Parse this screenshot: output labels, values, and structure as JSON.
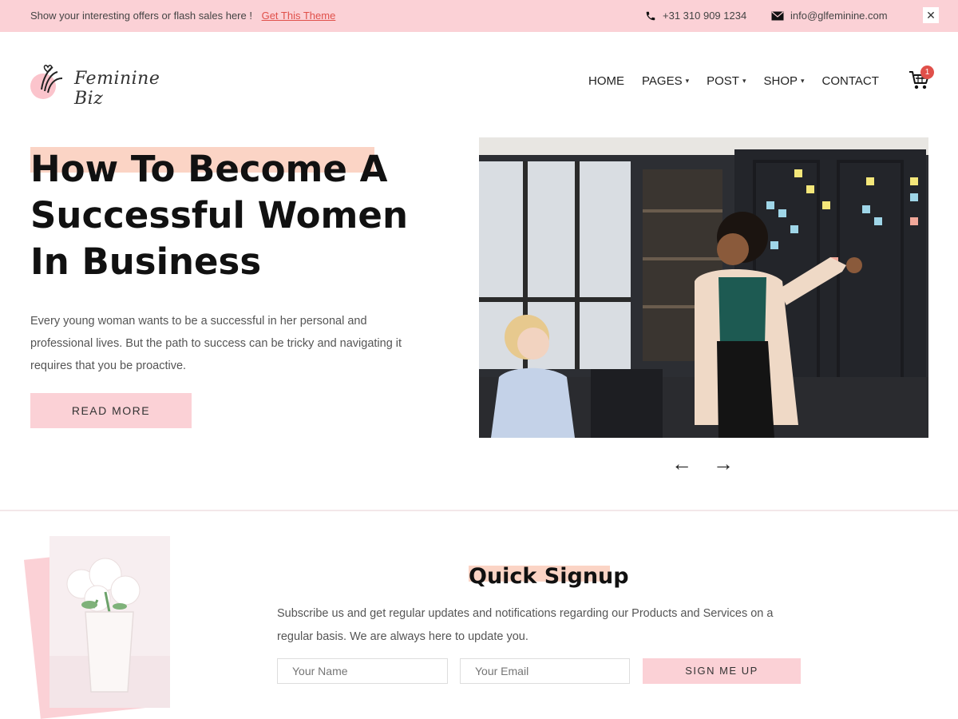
{
  "topbar": {
    "offer_text": "Show your interesting offers or flash sales here !",
    "offer_link": "Get This Theme",
    "phone": "+31 310 909 1234",
    "email": "info@glfeminine.com",
    "phone_icon": "phone-icon",
    "email_icon": "mail-icon",
    "close_icon": "close-icon"
  },
  "header": {
    "logo_text": "Feminine Biz",
    "nav": [
      {
        "label": "HOME",
        "dropdown": false
      },
      {
        "label": "PAGES",
        "dropdown": true
      },
      {
        "label": "POST",
        "dropdown": true
      },
      {
        "label": "SHOP",
        "dropdown": true
      },
      {
        "label": "CONTACT",
        "dropdown": false
      }
    ],
    "cart_count": "1"
  },
  "hero": {
    "title": "How To Become A Successful Women In Business",
    "description": "Every young woman wants to be a successful in her personal and professional lives. But the path to success can be tricky and navigating it requires that you be proactive.",
    "button": "READ MORE",
    "prev_icon": "arrow-left-icon",
    "next_icon": "arrow-right-icon"
  },
  "signup": {
    "title": "Quick Signup",
    "description": "Subscribe us and get regular updates and notifications regarding our Products and Services on a regular basis. We are always here to update you.",
    "name_placeholder": "Your Name",
    "email_placeholder": "Your Email",
    "button": "SIGN ME UP"
  },
  "colors": {
    "accent_pink": "#fbd1d6",
    "highlight_peach": "#fbd4c5",
    "link_red": "#e0504a"
  }
}
